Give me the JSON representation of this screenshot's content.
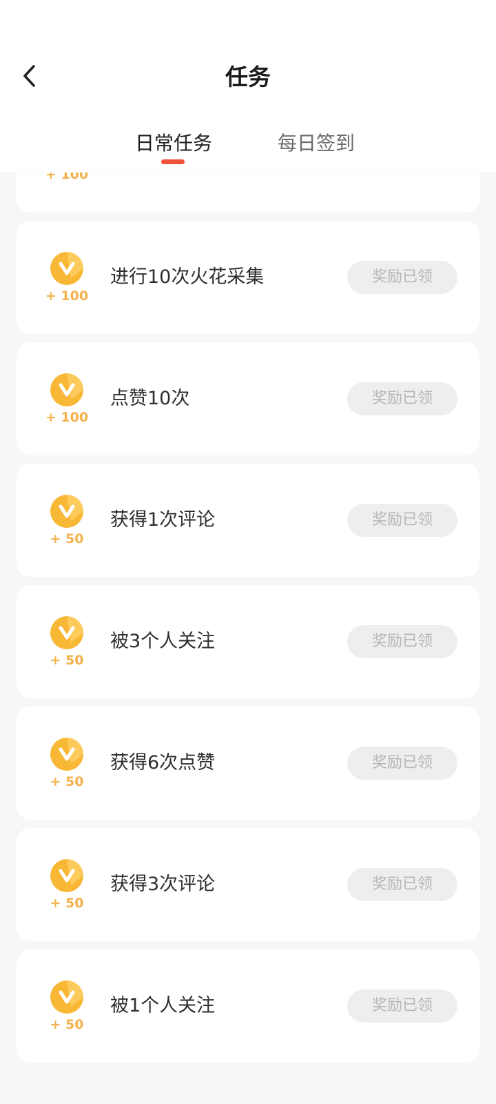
{
  "header": {
    "title": "任务",
    "back_icon": "chevron-left-icon"
  },
  "tabs": [
    {
      "label": "日常任务",
      "active": true
    },
    {
      "label": "每日签到",
      "active": false
    }
  ],
  "colors": {
    "accent": "#f0513a",
    "coin_gold": "#f8b734",
    "reward_text": "#f3b24c",
    "claimed_bg": "#eeeeee",
    "claimed_text": "#b6b6b6"
  },
  "tasks": [
    {
      "reward": "+ 100",
      "name": "",
      "status": ""
    },
    {
      "reward": "+ 100",
      "name": "进行10次火花采集",
      "status": "奖励已领"
    },
    {
      "reward": "+ 100",
      "name": "点赞10次",
      "status": "奖励已领"
    },
    {
      "reward": "+ 50",
      "name": "获得1次评论",
      "status": "奖励已领"
    },
    {
      "reward": "+ 50",
      "name": "被3个人关注",
      "status": "奖励已领"
    },
    {
      "reward": "+ 50",
      "name": "获得6次点赞",
      "status": "奖励已领"
    },
    {
      "reward": "+ 50",
      "name": "获得3次评论",
      "status": "奖励已领"
    },
    {
      "reward": "+ 50",
      "name": "被1个人关注",
      "status": "奖励已领"
    }
  ]
}
